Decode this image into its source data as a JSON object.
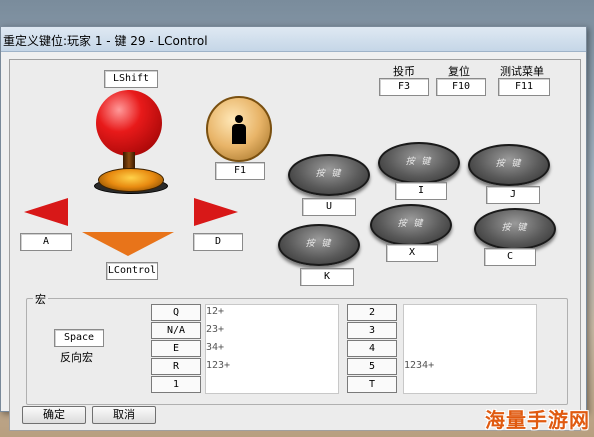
{
  "window": {
    "title": "重定义键位:玩家 1 - 键 29 - LControl"
  },
  "joystick": {
    "up_key": "LShift",
    "left_key": "A",
    "right_key": "D",
    "down_key": "LControl"
  },
  "person_button": {
    "key": "F1"
  },
  "system": [
    {
      "label": "投币",
      "key": "F3"
    },
    {
      "label": "复位",
      "key": "F10"
    },
    {
      "label": "测试菜单",
      "key": "F11"
    }
  ],
  "buttons": [
    {
      "text": "按 键",
      "key": "U"
    },
    {
      "text": "按 键",
      "key": "I"
    },
    {
      "text": "按 键",
      "key": "J"
    },
    {
      "text": "按 键",
      "key": "K"
    },
    {
      "text": "按 键",
      "key": "X"
    },
    {
      "text": "按 键",
      "key": "C"
    }
  ],
  "macro": {
    "title": "宏",
    "key": "Space",
    "reverse_label": "反向宏",
    "left_keys": [
      "Q",
      "N/A",
      "E",
      "R",
      "1"
    ],
    "left_lines": [
      "12+",
      "23+",
      "34+",
      "123+"
    ],
    "right_keys": [
      "2",
      "3",
      "4",
      "5",
      "T"
    ],
    "right_lines": [
      "1234+"
    ]
  },
  "footer": {
    "ok": "确定",
    "cancel": "取消"
  },
  "watermark": "海量手游网"
}
